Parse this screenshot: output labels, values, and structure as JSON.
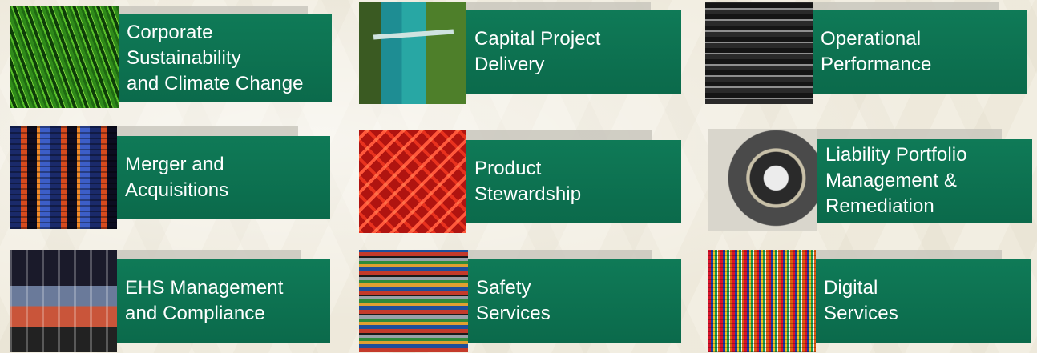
{
  "tiles": [
    {
      "id": "corporate-sustainability",
      "label": "Corporate\nSustainability\nand Climate Change",
      "image": "grass-photo"
    },
    {
      "id": "capital-project-delivery",
      "label": "Capital Project\nDelivery",
      "image": "river-bridge-photo"
    },
    {
      "id": "operational-performance",
      "label": "Operational\nPerformance",
      "image": "machinery-photo"
    },
    {
      "id": "merger-acquisitions",
      "label": "Merger and\nAcquisitions",
      "image": "city-buildings-photo"
    },
    {
      "id": "product-stewardship",
      "label": "Product\nStewardship",
      "image": "red-mesh-photo"
    },
    {
      "id": "liability-portfolio",
      "label": "Liability Portfolio\nManagement &\nRemediation",
      "image": "industrial-drum-photo"
    },
    {
      "id": "ehs-management",
      "label": "EHS Management\nand Compliance",
      "image": "industrial-tunnel-photo"
    },
    {
      "id": "safety-services",
      "label": "Safety\nServices",
      "image": "shipping-containers-photo"
    },
    {
      "id": "digital-services",
      "label": "Digital\nServices",
      "image": "colorful-pixels-photo"
    }
  ],
  "colors": {
    "panel": "#0f7a57",
    "panel_dark": "#0b6a4b",
    "text": "#ffffff",
    "background": "#f2eee2"
  }
}
